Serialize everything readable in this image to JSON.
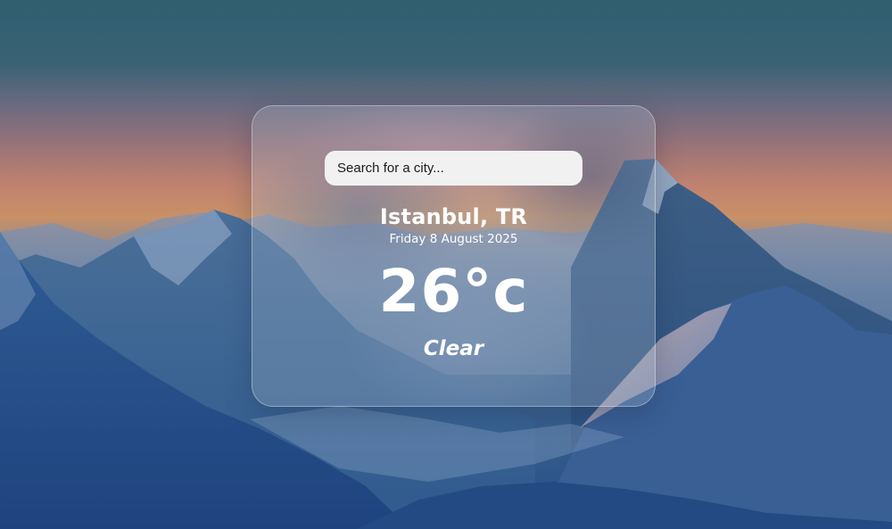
{
  "colors": {
    "sky_top": "#2f5f70",
    "sunset": "#c08270",
    "mountain_dark": "#274e88",
    "card_text": "#ffffff",
    "search_bg": "#f1f1f1"
  },
  "search": {
    "placeholder": "Search for a city...",
    "value": "",
    "icon": "none"
  },
  "weather": {
    "location": "Istanbul, TR",
    "date": "Friday 8 August 2025",
    "temperature": "26°c",
    "condition": "Clear"
  },
  "background": {
    "scene": "mountain-landscape-illustration"
  }
}
